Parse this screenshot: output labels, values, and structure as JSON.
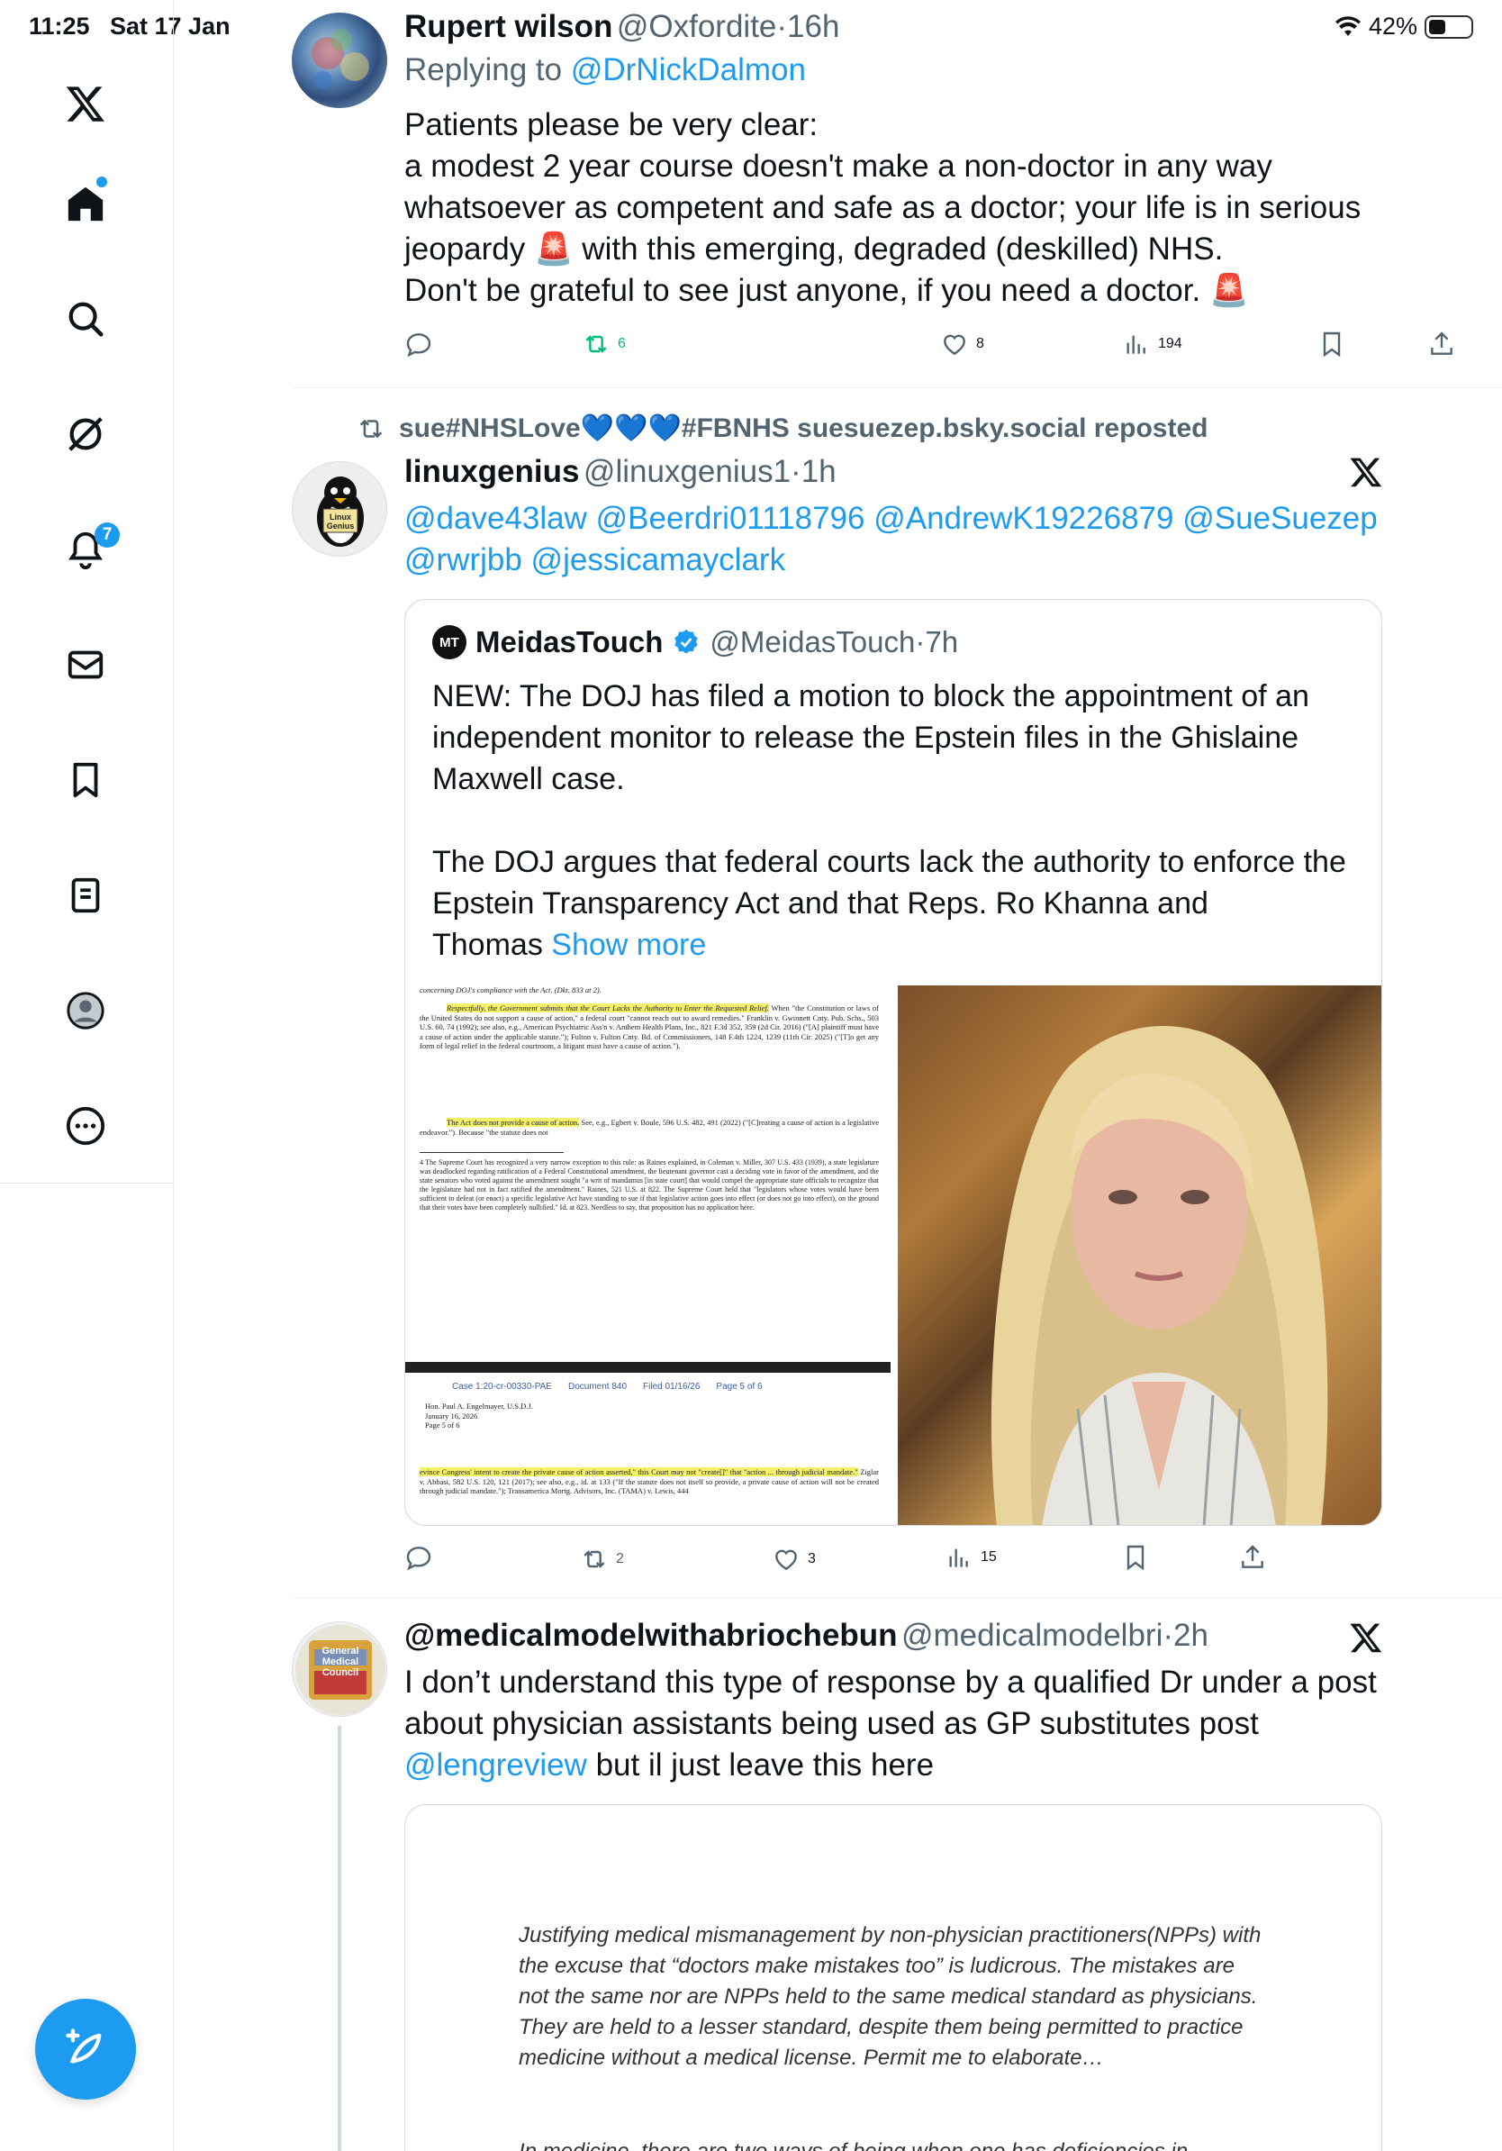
{
  "status_bar": {
    "time": "11:25",
    "date": "Sat 17 Jan",
    "battery": "42%",
    "battery_level": 0.42
  },
  "sidebar": {
    "items": [
      {
        "name": "x-logo",
        "icon": "x-logo-icon"
      },
      {
        "name": "home",
        "icon": "home-icon"
      },
      {
        "name": "search",
        "icon": "search-icon"
      },
      {
        "name": "grok",
        "icon": "grok-icon"
      },
      {
        "name": "notifications",
        "icon": "bell-icon",
        "badge": "7"
      },
      {
        "name": "messages",
        "icon": "envelope-icon"
      },
      {
        "name": "bookmarks",
        "icon": "bookmark-icon"
      },
      {
        "name": "lists",
        "icon": "list-icon"
      },
      {
        "name": "profile",
        "icon": "profile-icon"
      },
      {
        "name": "more",
        "icon": "more-icon"
      }
    ],
    "compose_icon": "compose-icon"
  },
  "tweets": [
    {
      "name": "Rupert wilson",
      "handle": "@Oxfordite",
      "sep": "·",
      "time": "16h",
      "replying_prefix": "Replying to ",
      "replying_to": "@DrNickDalmon",
      "lines": [
        "Patients please be very clear:",
        "a modest 2 year course doesn't make a non-doctor in any way",
        "whatsoever as competent and safe as a doctor; your life is in serious"
      ],
      "line4_a": "jeopardy ",
      "line4_b": " with this emerging, degraded (deskilled) NHS.",
      "line5": "Don't be grateful to see just anyone, if you need a doctor. ",
      "emoji": "🚨",
      "reposts": "6",
      "likes": "8",
      "views": "194"
    },
    {
      "repost_label": "sue#NHSLove💙💙💙#FBNHS suesuezep.bsky.social reposted",
      "name": "linuxgenius",
      "handle": "@linuxgenius1",
      "sep": "·",
      "time": "1h",
      "avatar_text": "Linux Genius",
      "mentions_line1": "@dave43law @Beerdri01118796 @AndrewK19226879 @SueSuezep",
      "mentions_line2": "@rwrjbb @jessicamayclark",
      "quote": {
        "logo": "MT",
        "name": "MeidasTouch",
        "handle": "@MeidasTouch",
        "sep": "·",
        "time": "7h",
        "lines": [
          "NEW: The DOJ has filed a motion to block the appointment of an",
          "independent monitor to release the Epstein files in the Ghislaine",
          "Maxwell case.",
          "",
          "The DOJ argues that federal courts lack the authority to enforce the",
          "Epstein Transparency Act and that Reps. Ro Khanna and"
        ],
        "last_line": "Thomas ",
        "show_more": "Show more",
        "doc": {
          "top_line": "concerning DOJ's compliance with the Act. (Dkt. 833 at 2).",
          "para1_hl": "Respectfully, the Government submits that the Court Lacks the Authority to Enter the Requested Relief.",
          "para1": " When \"the Constitution or laws of the United States do not support a cause of action,\" a federal court \"cannot reach out to award remedies.\" Franklin v. Gwinnett Cnty. Pub. Schs., 503 U.S. 60, 74 (1992); see also, e.g., American Psychiatric Ass'n v. Anthem Health Plans, Inc., 821 F.3d 352, 359 (2d Cir. 2016) (\"[A] plaintiff must have a cause of action under the applicable statute.\"); Fulton v. Fulton Cnty. Bd. of Commissioners, 148 F.4th 1224, 1239 (11th Cir. 2025) (\"[T]o get any form of legal relief in the federal courtroom, a litigant must have a cause of action.\").",
          "para2_hl": "The Act does not provide a cause of action.",
          "para2": " See, e.g., Egbert v. Boule, 596 U.S. 482, 491 (2022) (\"[C]reating a cause of action is a legislative endeavor.\"). Because \"the statute does not",
          "footnote": "4 The Supreme Court has recognized a very narrow exception to this rule: as Raines explained, in Coleman v. Miller, 307 U.S. 433 (1939), a state legislature was deadlocked regarding ratification of a Federal Constitutional amendment, the lieutenant governor cast a deciding vote in favor of the amendment, and the state senators who voted against the amendment sought \"a writ of mandamus [in state court] that would compel the appropriate state officials to recognize that the legislature had not in fact ratified the amendment.\" Raines, 521 U.S. at 822. The Supreme Court held that \"legislators whose votes would have been sufficient to defeat (or enact) a specific legislative Act have standing to sue if that legislative action goes into effect (or does not go into effect), on the ground that their votes have been completely nullified.\" Id. at 823. Needless to say, that proposition has no application here.",
          "header_case": "Case 1:20-cr-00330-PAE",
          "header_doc": "Document 840",
          "header_filed": "Filed 01/16/26",
          "header_page": "Page 5 of 6",
          "addr1": "Hon. Paul A. Engelmayer, U.S.D.J.",
          "addr2": "January 16, 2026",
          "addr3": "Page 5 of 6",
          "bottom_hl": "evince Congress' intent to create the private cause of action asserted,\" this Court may not \"create[]\" that \"action ... through judicial mandate.\"",
          "bottom": " Ziglar v. Abbasi, 582 U.S. 120, 121 (2017); see also, e.g., id. at 133 (\"If the statute does not itself so provide, a private cause of action will not be created through judicial mandate.\"); Transamerica Mortg. Advisors, Inc. (TAMA) v. Lewis, 444"
        }
      },
      "reposts": "2",
      "likes": "3",
      "views": "15"
    },
    {
      "name": "@medicalmodelwithabriochebun",
      "handle": "@medicalmodelbri",
      "sep": "·",
      "time": "2h",
      "avatar_text": "General Medical Council",
      "lines": [
        "I don’t understand this type of response by a qualified Dr under a post",
        "about physician assistants being used as GP substitutes post"
      ],
      "link": "@lengreview",
      "link_tail": " but il just leave this here",
      "card_text": "Justifying medical mismanagement by non-physician practitioners(NPPs) with the excuse that “doctors make mistakes too” is ludicrous. The mistakes are not the same nor are NPPs held to the same medical standard as physicians. They are held to a lesser standard, despite them being permitted to practice medicine without a medical license. Permit me to elaborate…",
      "card_text2": "In medicine, there are two ways of being when one has deficiencies in"
    }
  ]
}
